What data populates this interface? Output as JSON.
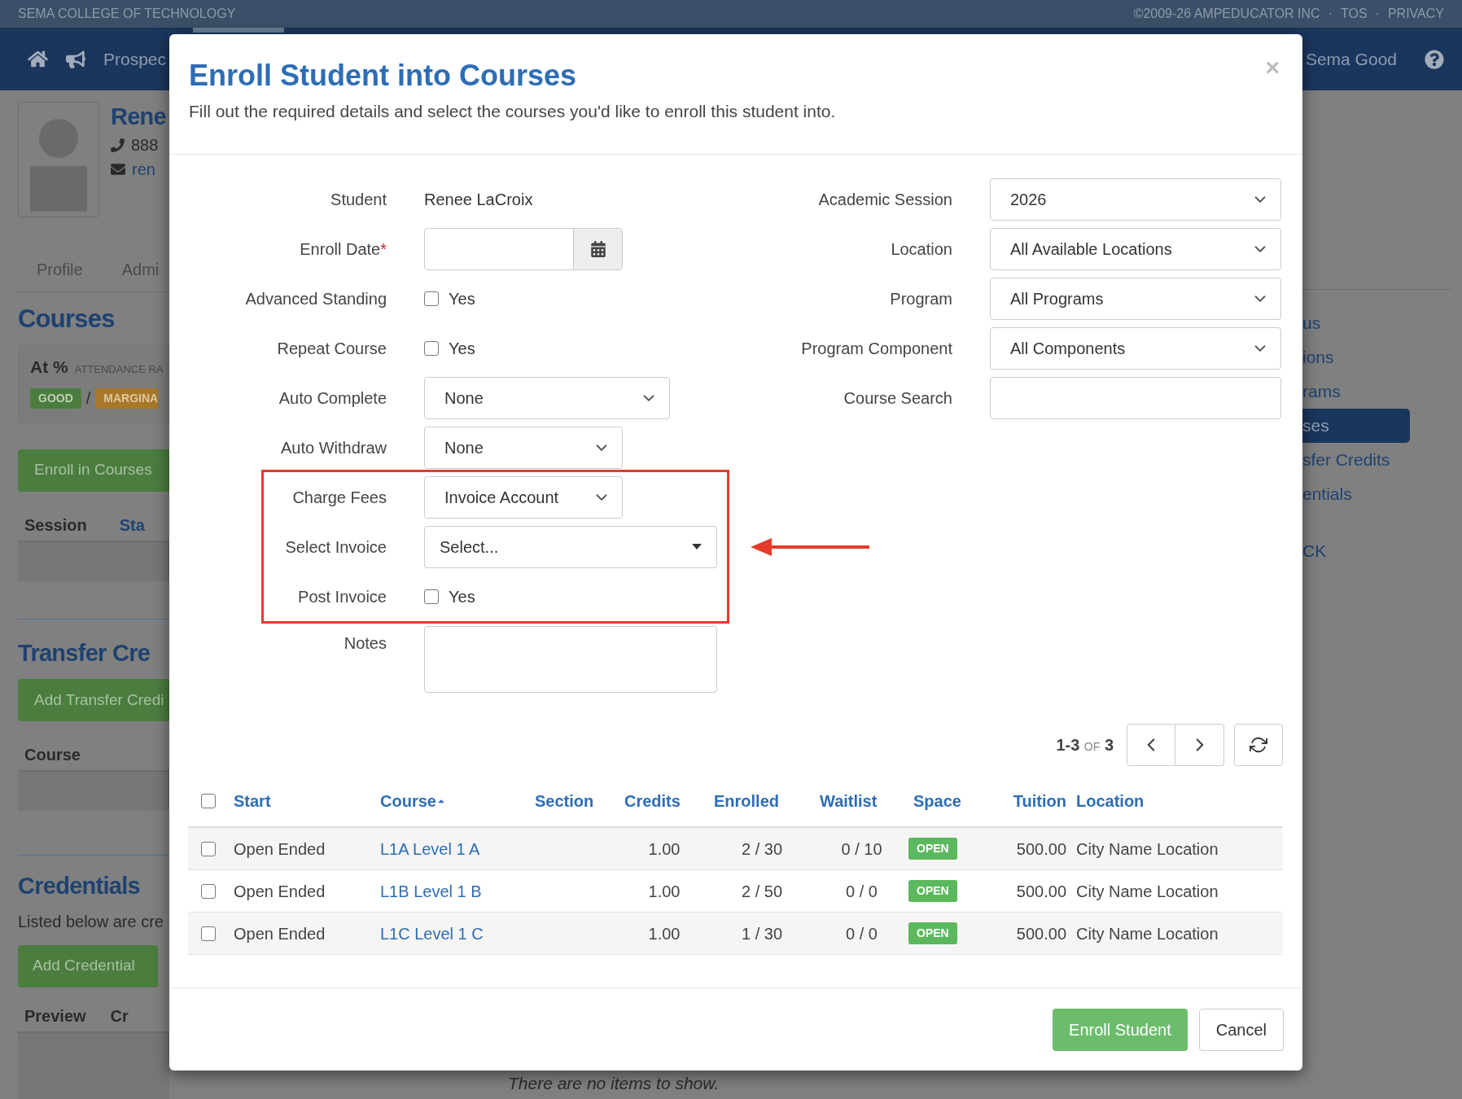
{
  "top_bar": {
    "school": "SEMA COLLEGE OF TECHNOLOGY",
    "copyright": "©2009-26 AMPEDUCATOR INC",
    "links": [
      "TOS",
      "PRIVACY"
    ],
    "separator": "·"
  },
  "nav": {
    "item": "Prospec",
    "user": "Sema Good"
  },
  "profile": {
    "name": "Rene",
    "phone": "888",
    "email": "ren",
    "tabs": [
      "Profile",
      "Admi"
    ]
  },
  "courses_section": {
    "heading": "Courses",
    "attendance_value": "At %",
    "attendance_label": "ATTENDANCE RA",
    "badges": [
      {
        "label": "GOOD",
        "color": "#4b7d3f"
      },
      {
        "label": "MARGINA",
        "color": "#a8782a"
      }
    ],
    "separator": "/",
    "button": "Enroll in Courses",
    "columns": [
      "Session",
      "Sta"
    ]
  },
  "transfer_section": {
    "heading": "Transfer Cre",
    "button": "Add Transfer Credi",
    "columns": [
      "Course"
    ]
  },
  "credentials_section": {
    "heading": "Credentials",
    "text": "Listed below are cre",
    "button": "Add Credential",
    "columns": [
      "Preview",
      "Cr"
    ],
    "empty": "There are no items to show."
  },
  "side_nav": [
    {
      "label": "us",
      "selected": false
    },
    {
      "label": "ions",
      "selected": false
    },
    {
      "label": "rams",
      "selected": false
    },
    {
      "label": "ses",
      "selected": true
    },
    {
      "label": "sfer Credits",
      "selected": false
    },
    {
      "label": "entials",
      "selected": false
    },
    {
      "label": "CK",
      "selected": false
    }
  ],
  "dialog": {
    "title": "Enroll Student into Courses",
    "subtitle": "Fill out the required details and select the courses you'd like to enroll this student into.",
    "close": "×",
    "required_mark": "*",
    "left_fields": [
      {
        "label": "Student",
        "kind": "text",
        "value": "Renee LaCroix",
        "required": false,
        "highlighted": false
      },
      {
        "label": "Enroll Date",
        "kind": "date",
        "required": true,
        "highlighted": false
      },
      {
        "label": "Advanced Standing",
        "kind": "checkbox",
        "option": "Yes",
        "checked": false,
        "required": false,
        "highlighted": false
      },
      {
        "label": "Repeat Course",
        "kind": "checkbox",
        "option": "Yes",
        "checked": false,
        "required": false,
        "highlighted": false
      },
      {
        "label": "Auto Complete",
        "kind": "select",
        "value": "None",
        "required": false,
        "highlighted": false
      },
      {
        "label": "Auto Withdraw",
        "kind": "select",
        "value": "None",
        "required": false,
        "highlighted": false
      },
      {
        "label": "Charge Fees",
        "kind": "select",
        "value": "Invoice Account",
        "required": false,
        "highlighted": true
      },
      {
        "label": "Select Invoice",
        "kind": "combobox",
        "value": "Select...",
        "required": false,
        "highlighted": true
      },
      {
        "label": "Post Invoice",
        "kind": "checkbox",
        "option": "Yes",
        "checked": false,
        "required": false,
        "highlighted": true
      },
      {
        "label": "Notes",
        "kind": "textarea",
        "required": false,
        "highlighted": false
      }
    ],
    "right_fields": [
      {
        "label": "Academic Session",
        "kind": "select",
        "value": "2026"
      },
      {
        "label": "Location",
        "kind": "select",
        "value": "All Available Locations"
      },
      {
        "label": "Program",
        "kind": "select",
        "value": "All Programs"
      },
      {
        "label": "Program Component",
        "kind": "select",
        "value": "All Components"
      },
      {
        "label": "Course Search",
        "kind": "input"
      }
    ],
    "pager": {
      "range": "1-3",
      "of": "OF",
      "total": "3"
    },
    "table": {
      "all_checked": false,
      "columns": [
        {
          "label": "Start",
          "sorted": false
        },
        {
          "label": "Course",
          "sorted": true
        },
        {
          "label": "Section",
          "sorted": false
        },
        {
          "label": "Credits",
          "sorted": false
        },
        {
          "label": "Enrolled",
          "sorted": false
        },
        {
          "label": "Waitlist",
          "sorted": false
        },
        {
          "label": "Space",
          "sorted": false
        },
        {
          "label": "Tuition",
          "sorted": false
        },
        {
          "label": "Location",
          "sorted": false
        }
      ],
      "rows": [
        {
          "checked": false,
          "start": "Open Ended",
          "course": "L1A Level 1 A",
          "credits": "1.00",
          "enrolled": "2 / 30",
          "waitlist": "0 / 10",
          "space": "OPEN",
          "tuition": "500.00",
          "location": "City Name Location"
        },
        {
          "checked": false,
          "start": "Open Ended",
          "course": "L1B Level 1 B",
          "credits": "1.00",
          "enrolled": "2 / 50",
          "waitlist": "0 / 0",
          "space": "OPEN",
          "tuition": "500.00",
          "location": "City Name Location"
        },
        {
          "checked": false,
          "start": "Open Ended",
          "course": "L1C Level 1 C",
          "credits": "1.00",
          "enrolled": "1 / 30",
          "waitlist": "0 / 0",
          "space": "OPEN",
          "tuition": "500.00",
          "location": "City Name Location"
        }
      ]
    },
    "buttons": [
      {
        "label": "Enroll Student",
        "kind": "primary"
      },
      {
        "label": "Cancel",
        "kind": "default"
      }
    ]
  }
}
